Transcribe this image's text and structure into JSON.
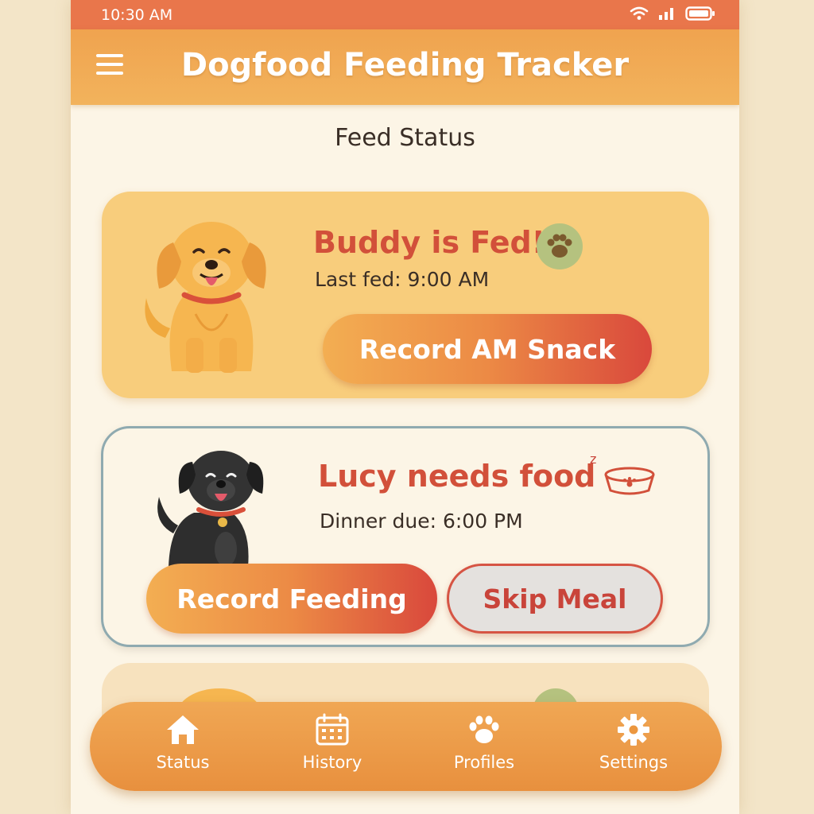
{
  "status_bar": {
    "time": "10:30 AM",
    "icons": [
      "wifi-icon",
      "signal-icon",
      "battery-icon"
    ]
  },
  "app_bar": {
    "title": "Dogfood Feeding Tracker",
    "menu_icon": "hamburger-menu-icon"
  },
  "section_title": "Feed Status",
  "cards": [
    {
      "dog_icon": "golden-dog-illustration",
      "heading": "Buddy is Fed!",
      "status_icon": "paw-icon",
      "subtext": "Last fed: 9:00 AM",
      "primary_button": "Record AM Snack"
    },
    {
      "dog_icon": "black-dog-illustration",
      "heading": "Lucy needs food",
      "status_icon": "empty-bowl-icon",
      "subtext": "Dinner due: 6:00 PM",
      "primary_button": "Record Feeding",
      "secondary_button": "Skip Meal"
    }
  ],
  "bottom_nav": [
    {
      "label": "Status",
      "icon": "home-icon"
    },
    {
      "label": "History",
      "icon": "calendar-icon"
    },
    {
      "label": "Profiles",
      "icon": "paw-icon"
    },
    {
      "label": "Settings",
      "icon": "gear-icon"
    }
  ],
  "colors": {
    "status_bar": "#e9764b",
    "app_bar": "#f0a34f",
    "accent_red": "#d2503a",
    "card_fed": "#f8cd7c",
    "card_outline": "#8faab0",
    "paw_badge": "#b5c27f"
  }
}
